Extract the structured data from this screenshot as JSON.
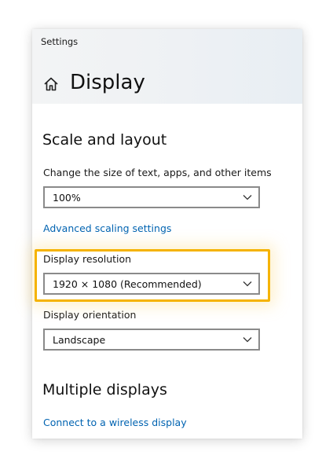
{
  "window": {
    "app_title": "Settings",
    "page_title": "Display",
    "home_icon": "home-icon"
  },
  "scale_layout": {
    "title": "Scale and layout",
    "size_label": "Change the size of text, apps, and other items",
    "size_value": "100%",
    "advanced_link": "Advanced scaling settings",
    "resolution_label": "Display resolution",
    "resolution_value": "1920 × 1080 (Recommended)",
    "orientation_label": "Display orientation",
    "orientation_value": "Landscape"
  },
  "multiple_displays": {
    "title": "Multiple displays",
    "wireless_link": "Connect to a wireless display"
  },
  "colors": {
    "highlight": "#f5b301",
    "link": "#0063b1"
  }
}
